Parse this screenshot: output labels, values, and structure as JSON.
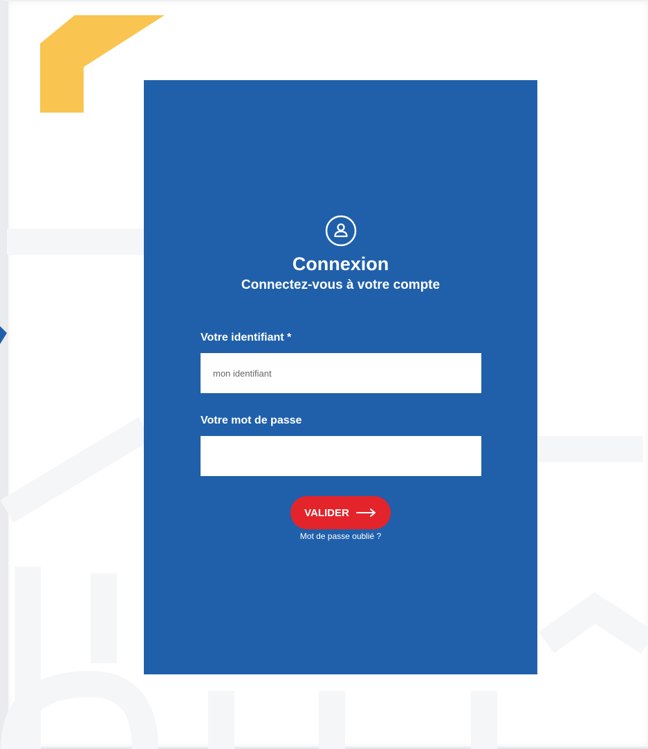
{
  "colors": {
    "card": "#2060aa",
    "accent_yellow": "#f9c550",
    "button": "#e3242b",
    "watermark": "#f6f7f9",
    "text": "#ffffff"
  },
  "header": {
    "icon": "user-icon",
    "title": "Connexion",
    "subtitle": "Connectez-vous à votre compte"
  },
  "form": {
    "identifier_label": "Votre identifiant *",
    "identifier_placeholder": "mon identifiant",
    "identifier_value": "",
    "password_label": "Votre mot de passe",
    "password_value": "",
    "submit_label": "VALIDER",
    "submit_icon": "arrow-right-icon",
    "forgot_link": "Mot de passe oublié ?"
  }
}
